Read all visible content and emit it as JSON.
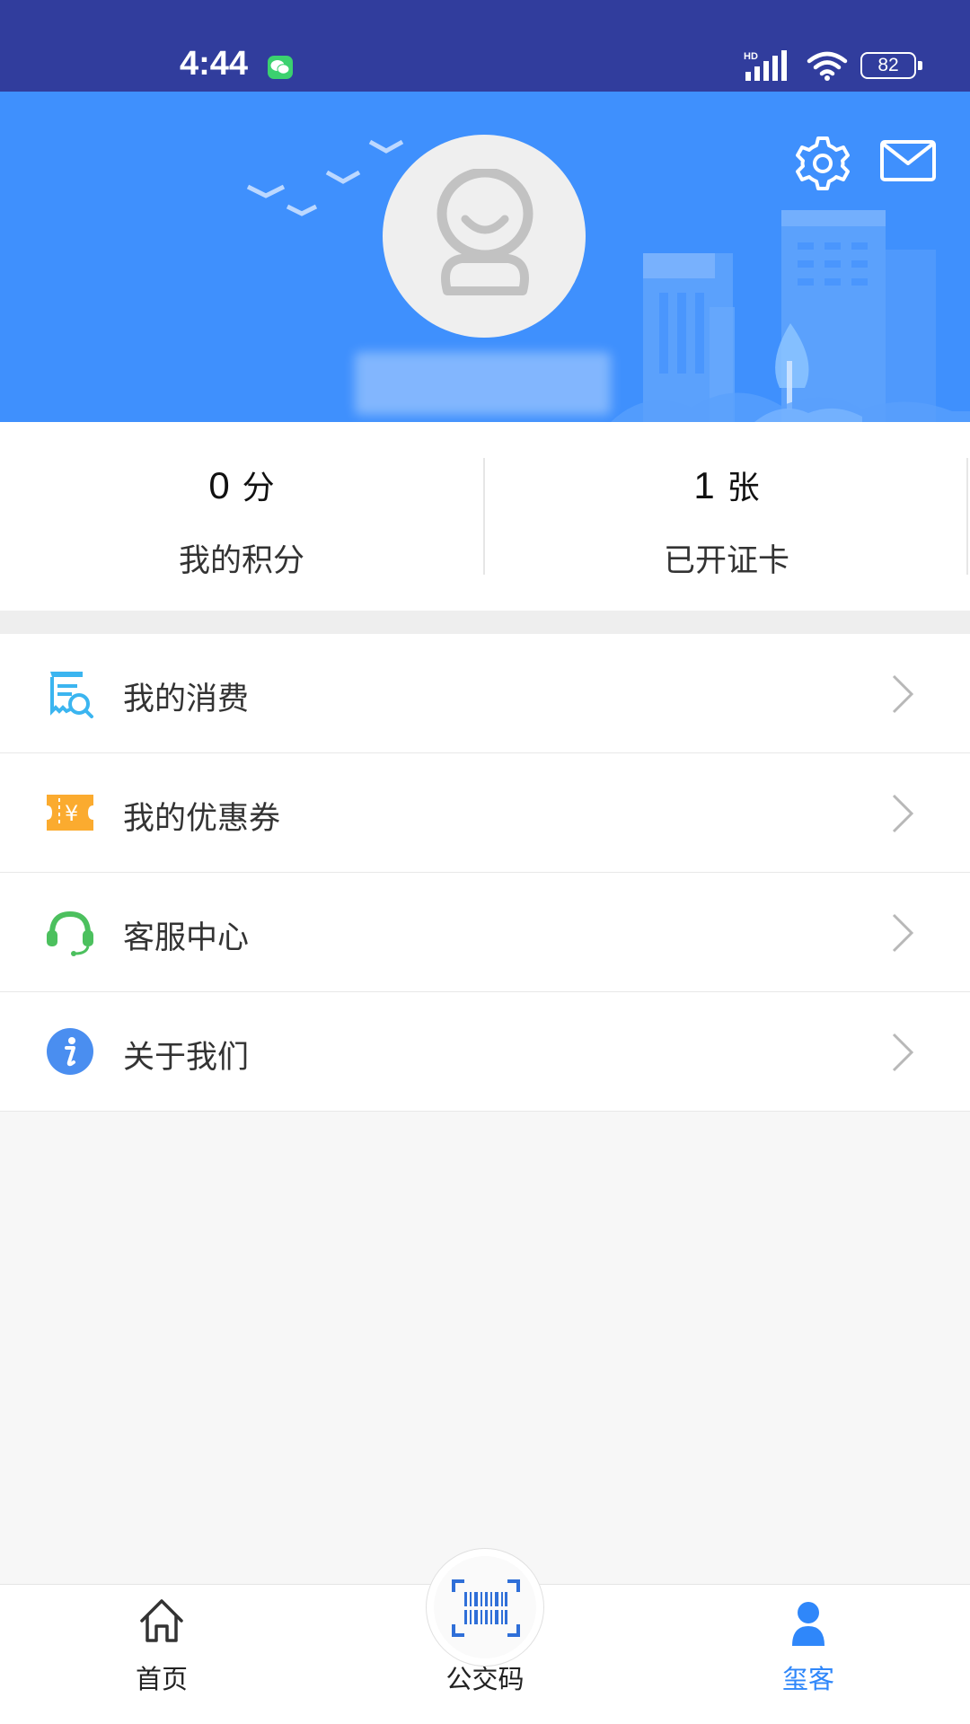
{
  "status_bar": {
    "time": "4:44",
    "network": "HD",
    "battery": "82",
    "icons": [
      "wechat-icon",
      "signal-icon",
      "wifi-icon",
      "battery-icon"
    ]
  },
  "header": {
    "avatar": "default-avatar-icon",
    "icons": [
      "settings-icon",
      "mail-icon"
    ]
  },
  "stats": {
    "points": {
      "value": "0",
      "unit": "分",
      "label": "我的积分"
    },
    "cards": {
      "value": "1",
      "unit": "张",
      "label": "已开证卡"
    }
  },
  "menu": {
    "items": [
      {
        "label": "我的消费",
        "icon": "receipt-icon"
      },
      {
        "label": "我的优惠券",
        "icon": "coupon-icon"
      },
      {
        "label": "客服中心",
        "icon": "headset-icon"
      },
      {
        "label": "关于我们",
        "icon": "info-icon"
      }
    ]
  },
  "bottom_nav": {
    "items": [
      {
        "label": "首页",
        "icon": "home-icon"
      },
      {
        "label": "公交码",
        "icon": "barcode-scan-icon"
      },
      {
        "label": "玺客",
        "icon": "person-icon",
        "active": true
      }
    ]
  },
  "colors": {
    "status_bar": "#313d9d",
    "header": "#3f90fd",
    "active": "#2f87fa",
    "receipt": "#3bb5f0",
    "coupon": "#fbab2f",
    "headset": "#4cc05e",
    "info": "#4a8ef0"
  }
}
